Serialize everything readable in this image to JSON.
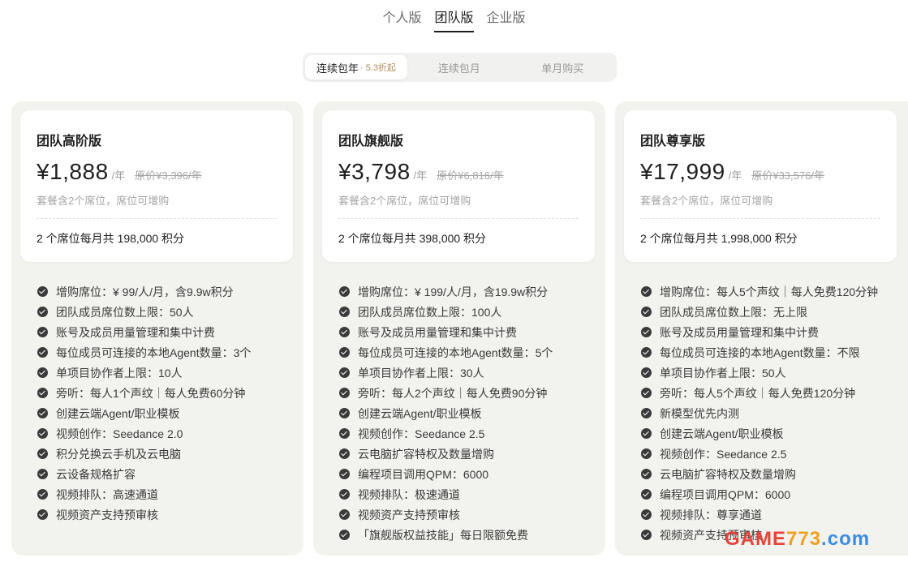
{
  "top_tabs": [
    {
      "label": "个人版",
      "active": false
    },
    {
      "label": "团队版",
      "active": true
    },
    {
      "label": "企业版",
      "active": false
    }
  ],
  "billing": {
    "options": [
      {
        "label": "连续包年",
        "discount": "· 5.3折起",
        "active": true
      },
      {
        "label": "连续包月",
        "active": false
      },
      {
        "label": "单月购买",
        "active": false
      }
    ]
  },
  "plans": [
    {
      "name": "团队高阶版",
      "price": "¥1,888",
      "per": "/年",
      "original": "原价¥3,396/年",
      "seats_note": "套餐含2个席位，席位可增购",
      "credits": "2 个席位每月共 198,000 积分",
      "features": [
        "增购席位：¥ 99/人/月，含9.9w积分",
        "团队成员席位数上限：50人",
        "账号及成员用量管理和集中计费",
        "每位成员可连接的本地Agent数量：3个",
        "单项目协作者上限：10人",
        "旁听：每人1个声纹｜每人免费60分钟",
        "创建云端Agent/职业模板",
        "视频创作：Seedance 2.0",
        "积分兑换云手机及云电脑",
        "云设备规格扩容",
        "视频排队：高速通道",
        "视频资产支持预审核"
      ]
    },
    {
      "name": "团队旗舰版",
      "price": "¥3,798",
      "per": "/年",
      "original": "原价¥6,816/年",
      "seats_note": "套餐含2个席位，席位可增购",
      "credits": "2 个席位每月共 398,000 积分",
      "features": [
        "增购席位：¥ 199/人/月，含19.9w积分",
        "团队成员席位数上限：100人",
        "账号及成员用量管理和集中计费",
        "每位成员可连接的本地Agent数量：5个",
        "单项目协作者上限：30人",
        "旁听：每人2个声纹｜每人免费90分钟",
        "创建云端Agent/职业模板",
        "视频创作：Seedance 2.5",
        "云电脑扩容特权及数量增购",
        "编程项目调用QPM：6000",
        "视频排队：极速通道",
        "视频资产支持预审核",
        "「旗舰版权益技能」每日限额免费"
      ]
    },
    {
      "name": "团队尊享版",
      "price": "¥17,999",
      "per": "/年",
      "original": "原价¥33,576/年",
      "seats_note": "套餐含2个席位，席位可增购",
      "credits": "2 个席位每月共 1,998,000 积分",
      "features": [
        "增购席位：每人5个声纹｜每人免费120分钟",
        "团队成员席位数上限：无上限",
        "账号及成员用量管理和集中计费",
        "每位成员可连接的本地Agent数量：不限",
        "单项目协作者上限：50人",
        "旁听：每人5个声纹｜每人免费120分钟",
        "新模型优先内测",
        "创建云端Agent/职业模板",
        "视频创作：Seedance 2.5",
        "云电脑扩容特权及数量增购",
        "编程项目调用QPM：6000",
        "视频排队：尊享通道",
        "视频资产支持预审核"
      ]
    }
  ],
  "watermark": {
    "part_a": "GAME",
    "part_b": "773",
    "part_c": ".com"
  }
}
